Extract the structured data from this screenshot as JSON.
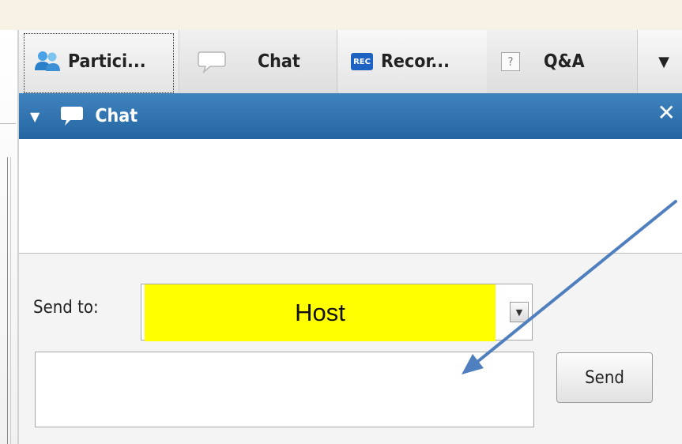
{
  "tabs": [
    {
      "label": "Partici...",
      "icon": "participants-icon"
    },
    {
      "label": "Chat",
      "icon": "chat-bubble-icon"
    },
    {
      "label": "Recor...",
      "icon": "record-icon",
      "icon_text": "REC"
    },
    {
      "label": "Q&A",
      "icon": "question-icon",
      "icon_text": "?"
    }
  ],
  "tab_more": "▼",
  "panel": {
    "title": "Chat",
    "collapse_glyph": "▼",
    "close_glyph": "✕"
  },
  "compose": {
    "send_to_label": "Send to:",
    "send_to_value": "Host",
    "dropdown_glyph": "▼",
    "message_value": "",
    "send_label": "Send"
  },
  "colors": {
    "header": "#2b6ea9",
    "highlight": "#ffff00",
    "annotation_arrow": "#4f7fbf"
  }
}
